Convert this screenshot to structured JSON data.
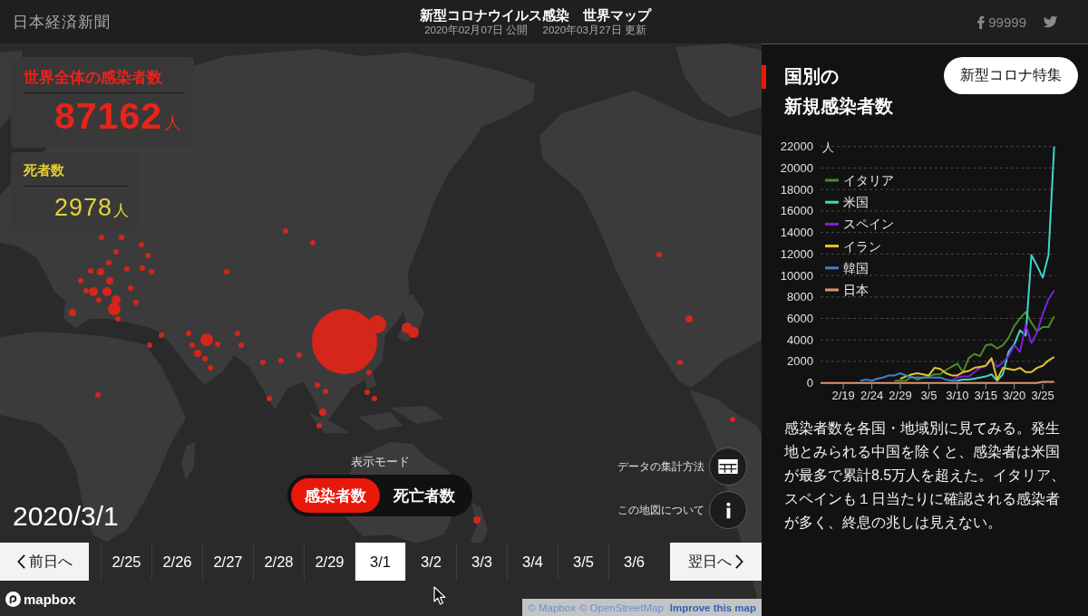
{
  "header": {
    "logo": "日本経済新聞",
    "title": "新型コロナウイルス感染　世界マップ",
    "published": "2020年02月07日 公開",
    "updated": "2020年03月27日 更新",
    "share_count": "99999"
  },
  "stats": [
    {
      "kind": "cases",
      "label": "世界全体の感染者数",
      "value": "87162",
      "unit": "人"
    },
    {
      "kind": "deaths",
      "label": "死者数",
      "value": "2978",
      "unit": "人"
    }
  ],
  "map": {
    "current_date": "2020/3/1",
    "mode_label": "表示モード",
    "modes": [
      {
        "label": "感染者数",
        "selected": true
      },
      {
        "label": "死亡者数",
        "selected": false
      }
    ],
    "info_buttons": [
      {
        "kind": "table",
        "label": "データの集計方法"
      },
      {
        "kind": "info",
        "label": "この地図について"
      }
    ],
    "prev_button": "前日へ",
    "next_button": "翌日へ",
    "dates": [
      {
        "label": "2/25",
        "selected": false
      },
      {
        "label": "2/26",
        "selected": false
      },
      {
        "label": "2/27",
        "selected": false
      },
      {
        "label": "2/28",
        "selected": false
      },
      {
        "label": "2/29",
        "selected": false
      },
      {
        "label": "3/1",
        "selected": true
      },
      {
        "label": "3/2",
        "selected": false
      },
      {
        "label": "3/3",
        "selected": false
      },
      {
        "label": "3/4",
        "selected": false
      },
      {
        "label": "3/5",
        "selected": false
      },
      {
        "label": "3/6",
        "selected": false
      }
    ],
    "mapbox_logo": "mapbox",
    "attribution": [
      "© Mapbox",
      "© OpenStreetMap"
    ],
    "improve_link": "Improve this map"
  },
  "panel": {
    "title": [
      "国別の",
      "新規感染者数"
    ],
    "button": "新型コロナ特集",
    "chart_data": {
      "type": "line",
      "ylabel": "人",
      "grid": true,
      "legend": "upper left",
      "categories": [
        null,
        null,
        null,
        null,
        "2/19",
        null,
        null,
        null,
        null,
        "2/24",
        null,
        null,
        null,
        null,
        "2/29",
        null,
        null,
        null,
        null,
        "3/5",
        null,
        null,
        null,
        null,
        "3/10",
        null,
        null,
        null,
        null,
        "3/15",
        null,
        null,
        null,
        null,
        "3/20",
        null,
        null,
        null,
        null,
        "3/25",
        null,
        null
      ],
      "ylim": [
        0,
        22000
      ],
      "yticks": [
        0,
        2000,
        4000,
        6000,
        8000,
        10000,
        12000,
        14000,
        16000,
        18000,
        20000,
        22000
      ],
      "series": [
        {
          "name": "イタリア",
          "color": "#4c8a2b",
          "values": [
            null,
            null,
            null,
            null,
            null,
            null,
            null,
            null,
            null,
            null,
            null,
            null,
            null,
            200,
            200,
            200,
            600,
            300,
            500,
            600,
            800,
            800,
            1200,
            1500,
            1800,
            1000,
            2300,
            2700,
            2500,
            3500,
            3600,
            3200,
            3500,
            4200,
            5300,
            6000,
            6600,
            5600,
            4800,
            5200,
            5200,
            6200
          ]
        },
        {
          "name": "米国",
          "color": "#3fd7c6",
          "values": [
            null,
            null,
            null,
            null,
            null,
            null,
            null,
            null,
            null,
            null,
            null,
            null,
            null,
            null,
            null,
            null,
            null,
            null,
            null,
            null,
            null,
            null,
            null,
            null,
            200,
            300,
            300,
            400,
            500,
            600,
            800,
            200,
            800,
            2900,
            3600,
            4900,
            4400,
            11900,
            10900,
            9800,
            11900,
            22000
          ]
        },
        {
          "name": "スペイン",
          "color": "#7a22dd",
          "values": [
            null,
            null,
            null,
            null,
            null,
            null,
            null,
            null,
            null,
            null,
            null,
            null,
            null,
            null,
            null,
            null,
            null,
            null,
            null,
            null,
            null,
            null,
            null,
            200,
            500,
            600,
            600,
            1000,
            1400,
            1600,
            2100,
            1500,
            1900,
            2500,
            3500,
            2900,
            5400,
            3700,
            4700,
            6400,
            7800,
            8600
          ]
        },
        {
          "name": "イラン",
          "color": "#e3c52c",
          "values": [
            null,
            null,
            null,
            null,
            null,
            null,
            null,
            null,
            null,
            null,
            null,
            null,
            null,
            null,
            400,
            600,
            800,
            900,
            800,
            700,
            1400,
            1300,
            900,
            700,
            700,
            1000,
            1100,
            1400,
            1500,
            1600,
            2300,
            300,
            1400,
            1300,
            1200,
            1400,
            1000,
            1000,
            1400,
            1600,
            2100,
            2400
          ]
        },
        {
          "name": "韓国",
          "color": "#3b82cf",
          "values": [
            null,
            null,
            null,
            null,
            null,
            null,
            null,
            200,
            300,
            200,
            400,
            500,
            700,
            700,
            900,
            700,
            500,
            500,
            500,
            500,
            500,
            500,
            300,
            200,
            200,
            null,
            null,
            null,
            null,
            null,
            null,
            null,
            null,
            null,
            null,
            null,
            null,
            null,
            null,
            null,
            null,
            null
          ]
        },
        {
          "name": "日本",
          "color": "#e09370",
          "values": [
            0,
            0,
            0,
            0,
            0,
            0,
            0,
            0,
            0,
            0,
            0,
            0,
            0,
            0,
            0,
            0,
            0,
            0,
            0,
            0,
            0,
            0,
            0,
            0,
            0,
            0,
            0,
            0,
            0,
            0,
            0,
            0,
            0,
            0,
            0,
            0,
            0,
            0,
            0,
            100,
            100,
            100
          ]
        }
      ]
    },
    "description": "感染者数を各国・地域別に見てみる。発生地とみられる中国を除くと、感染者は米国が最多で累計8.5万人を超えた。イタリア、スペインも１日当たりに確認される感染者が多く、終息の兆しは見えない。"
  }
}
